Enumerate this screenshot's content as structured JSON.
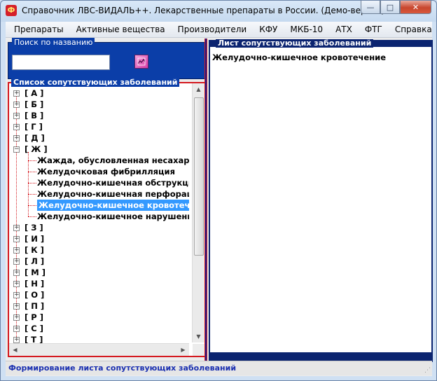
{
  "window": {
    "title": "Справочник ЛВС-ВИДАЛЬ++. Лекарственные препараты в России. (Демо-версия).",
    "icon": "app-logo-icon",
    "controls": {
      "minimize": "—",
      "maximize": "□",
      "close": "✕"
    }
  },
  "menu": [
    {
      "label": "Препараты"
    },
    {
      "label": "Активные вещества"
    },
    {
      "label": "Производители"
    },
    {
      "label": "КФУ"
    },
    {
      "label": "МКБ-10"
    },
    {
      "label": "АТХ"
    },
    {
      "label": "ФТГ"
    },
    {
      "label": "Справка"
    }
  ],
  "search": {
    "legend": "Поиск по названию",
    "value": "",
    "button_icon": "search-picture-icon"
  },
  "list": {
    "legend": "Список сопутствующих заболеваний",
    "tree": [
      {
        "label": "[ А ]",
        "expanded": false
      },
      {
        "label": "[ Б ]",
        "expanded": false
      },
      {
        "label": "[ В ]",
        "expanded": false
      },
      {
        "label": "[ Г ]",
        "expanded": false
      },
      {
        "label": "[ Д ]",
        "expanded": false
      },
      {
        "label": "[ Ж ]",
        "expanded": true,
        "children": [
          {
            "label": "Жажда, обусловленная несахарны"
          },
          {
            "label": "Желудочковая фибрилляция"
          },
          {
            "label": "Желудочно-кишечная обструкция."
          },
          {
            "label": "Желудочно-кишечная перфорация"
          },
          {
            "label": "Желудочно-кишечное кровотечение",
            "selected": true
          },
          {
            "label": "Желудочно-кишечное нарушение"
          }
        ]
      },
      {
        "label": "[ З ]",
        "expanded": false
      },
      {
        "label": "[ И ]",
        "expanded": false
      },
      {
        "label": "[ К ]",
        "expanded": false
      },
      {
        "label": "[ Л ]",
        "expanded": false
      },
      {
        "label": "[ М ]",
        "expanded": false
      },
      {
        "label": "[ Н ]",
        "expanded": false
      },
      {
        "label": "[ О ]",
        "expanded": false
      },
      {
        "label": "[ П ]",
        "expanded": false
      },
      {
        "label": "[ Р ]",
        "expanded": false
      },
      {
        "label": "[ С ]",
        "expanded": false
      },
      {
        "label": "[ Т ]",
        "expanded": false
      }
    ]
  },
  "sheet": {
    "legend": "Лист сопутствующих заболеваний",
    "items": [
      "Желудочно-кишечное кровотечение"
    ]
  },
  "status": {
    "text": "Формирование листа сопутствующих заболеваний"
  },
  "colors": {
    "accent_blue": "#0b3ea8",
    "frame_red": "#d4191f",
    "selection": "#3399ff",
    "status_text": "#1a2fb0"
  }
}
